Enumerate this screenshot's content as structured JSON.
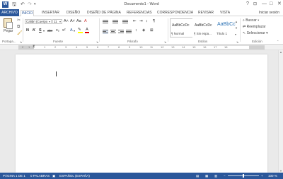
{
  "titlebar": {
    "logo": "W",
    "title": "Documento1 - Word",
    "help": "?",
    "ribbon_opts": "⊡",
    "minimize": "—",
    "maximize": "□",
    "close": "✕"
  },
  "quick_access": {
    "save": "🖫",
    "undo": "↶",
    "redo": "↷"
  },
  "tabs": {
    "file": "ARCHIVO",
    "home": "INICIO",
    "insert": "INSERTAR",
    "design": "DISEÑO",
    "layout": "DISEÑO DE PÁGINA",
    "references": "REFERENCIAS",
    "mailings": "CORRESPONDENCIA",
    "review": "REVISAR",
    "view": "VISTA"
  },
  "signin": "Iniciar sesión",
  "ribbon": {
    "paste_label": "Pegar",
    "font_name": "Calibri (Cuerpo",
    "font_size": "11",
    "grow": "A˄",
    "shrink": "A˅",
    "case": "Aa",
    "clear": "A",
    "bold": "N",
    "italic": "K",
    "underline": "S",
    "strike": "abc",
    "subscript": "x₂",
    "superscript": "x²",
    "pilcrow": "¶",
    "groups": {
      "clipboard": "Portapa...",
      "font": "Fuente",
      "paragraph": "Párrafo",
      "styles": "Estilos",
      "editing": "Edición"
    },
    "styles": [
      {
        "sample": "AaBbCcDc",
        "name": "¶ Normal"
      },
      {
        "sample": "AaBbCcDc",
        "name": "¶ Sin espa..."
      },
      {
        "sample": "AaBbCc",
        "name": "Título 1"
      }
    ],
    "editing": {
      "find": "Buscar",
      "replace": "Reemplazar",
      "select": "Seleccionar"
    }
  },
  "ruler": {
    "numbers": [
      "2",
      "1",
      "1",
      "2",
      "3",
      "4",
      "5",
      "6",
      "7",
      "8",
      "9",
      "10",
      "11",
      "12",
      "13",
      "14",
      "15",
      "16",
      "17",
      "18"
    ]
  },
  "status": {
    "page": "PÁGINA 1 DE 1",
    "words": "0 PALABRAS",
    "language": "ESPAÑOL (ESPAÑA)",
    "zoom": "100 %",
    "zoom_minus": "−",
    "zoom_plus": "+"
  },
  "colors": {
    "accent": "#2b579a",
    "highlight": "#ffff00",
    "font_color": "#e00000"
  }
}
